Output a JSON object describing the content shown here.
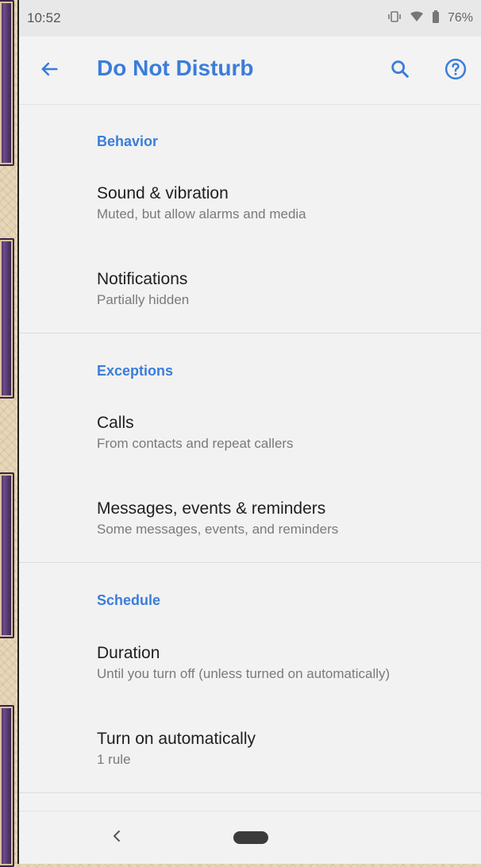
{
  "status_bar": {
    "time": "10:52",
    "battery_percent": "76%",
    "icons": [
      "vibrate-icon",
      "wifi-icon",
      "battery-icon"
    ]
  },
  "app_bar": {
    "title": "Do Not Disturb",
    "icons": [
      "back-arrow-icon",
      "search-icon",
      "help-icon"
    ]
  },
  "sections": {
    "behavior": {
      "title": "Behavior",
      "items": [
        {
          "title": "Sound & vibration",
          "subtitle": "Muted, but allow alarms and media"
        },
        {
          "title": "Notifications",
          "subtitle": "Partially hidden"
        }
      ]
    },
    "exceptions": {
      "title": "Exceptions",
      "items": [
        {
          "title": "Calls",
          "subtitle": "From contacts and repeat callers"
        },
        {
          "title": "Messages, events & reminders",
          "subtitle": "Some messages, events, and reminders"
        }
      ]
    },
    "schedule": {
      "title": "Schedule",
      "items": [
        {
          "title": "Duration",
          "subtitle": "Until you turn off (unless turned on automatically)"
        },
        {
          "title": "Turn on automatically",
          "subtitle": "1 rule"
        }
      ]
    }
  },
  "colors": {
    "accent": "#3b7ddb",
    "background": "#f2f2f2",
    "primary_text": "#202020",
    "secondary_text": "#7a7a7a"
  }
}
